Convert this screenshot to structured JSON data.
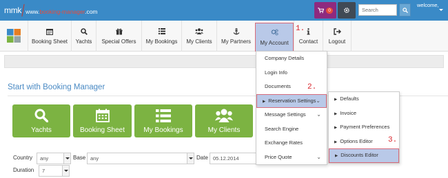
{
  "header": {
    "logo_brand": "mmk",
    "logo_url_prefix": "www.",
    "logo_url_brand": "booking-manager",
    "logo_url_suffix": ".com",
    "cart_badge": "0",
    "search_placeholder": "Search",
    "welcome": "welcome,"
  },
  "nav": {
    "items": [
      {
        "label": "Booking Sheet",
        "icon": "calendar-icon"
      },
      {
        "label": "Yachts",
        "icon": "search-icon"
      },
      {
        "label": "Special Offers",
        "icon": "gift-icon"
      },
      {
        "label": "My Bookings",
        "icon": "list-icon"
      },
      {
        "label": "My Clients",
        "icon": "users-icon"
      },
      {
        "label": "My Partners",
        "icon": "anchor-icon"
      },
      {
        "label": "My Account",
        "icon": "gears-icon"
      },
      {
        "label": "Contact",
        "icon": "info-icon"
      },
      {
        "label": "Logout",
        "icon": "logout-icon"
      }
    ]
  },
  "main": {
    "title": "Start with Booking Manager",
    "tiles": [
      {
        "label": "Yachts",
        "icon": "search-icon"
      },
      {
        "label": "Booking Sheet",
        "icon": "calendar-icon"
      },
      {
        "label": "My Bookings",
        "icon": "list-icon"
      },
      {
        "label": "My Clients",
        "icon": "users-icon"
      }
    ]
  },
  "form": {
    "country_label": "Country",
    "country_value": "any",
    "base_label": "Base",
    "base_value": "any",
    "date_label": "Date",
    "date_value": "05.12.2014",
    "duration_label": "Duration",
    "duration_value": "7"
  },
  "account_menu": {
    "items": [
      {
        "label": "Company Details"
      },
      {
        "label": "Login Info"
      },
      {
        "label": "Documents"
      },
      {
        "label": "Reservation Settings"
      },
      {
        "label": "Message Settings"
      },
      {
        "label": "Search Engine"
      },
      {
        "label": "Exchange Rates"
      },
      {
        "label": "Price Quote"
      }
    ]
  },
  "reservation_submenu": {
    "items": [
      {
        "label": "Defaults"
      },
      {
        "label": "Invoice"
      },
      {
        "label": "Payment Preferences"
      },
      {
        "label": "Options Editor"
      },
      {
        "label": "Discounts Editor"
      }
    ]
  },
  "steps": [
    "1.",
    "2.",
    "3."
  ],
  "colors": {
    "header_bg": "#3a8ac7",
    "tile_green": "#7cb342",
    "highlight_bg": "#b9c9e8",
    "highlight_border": "#d76a7a",
    "step_red": "#d8232a"
  }
}
